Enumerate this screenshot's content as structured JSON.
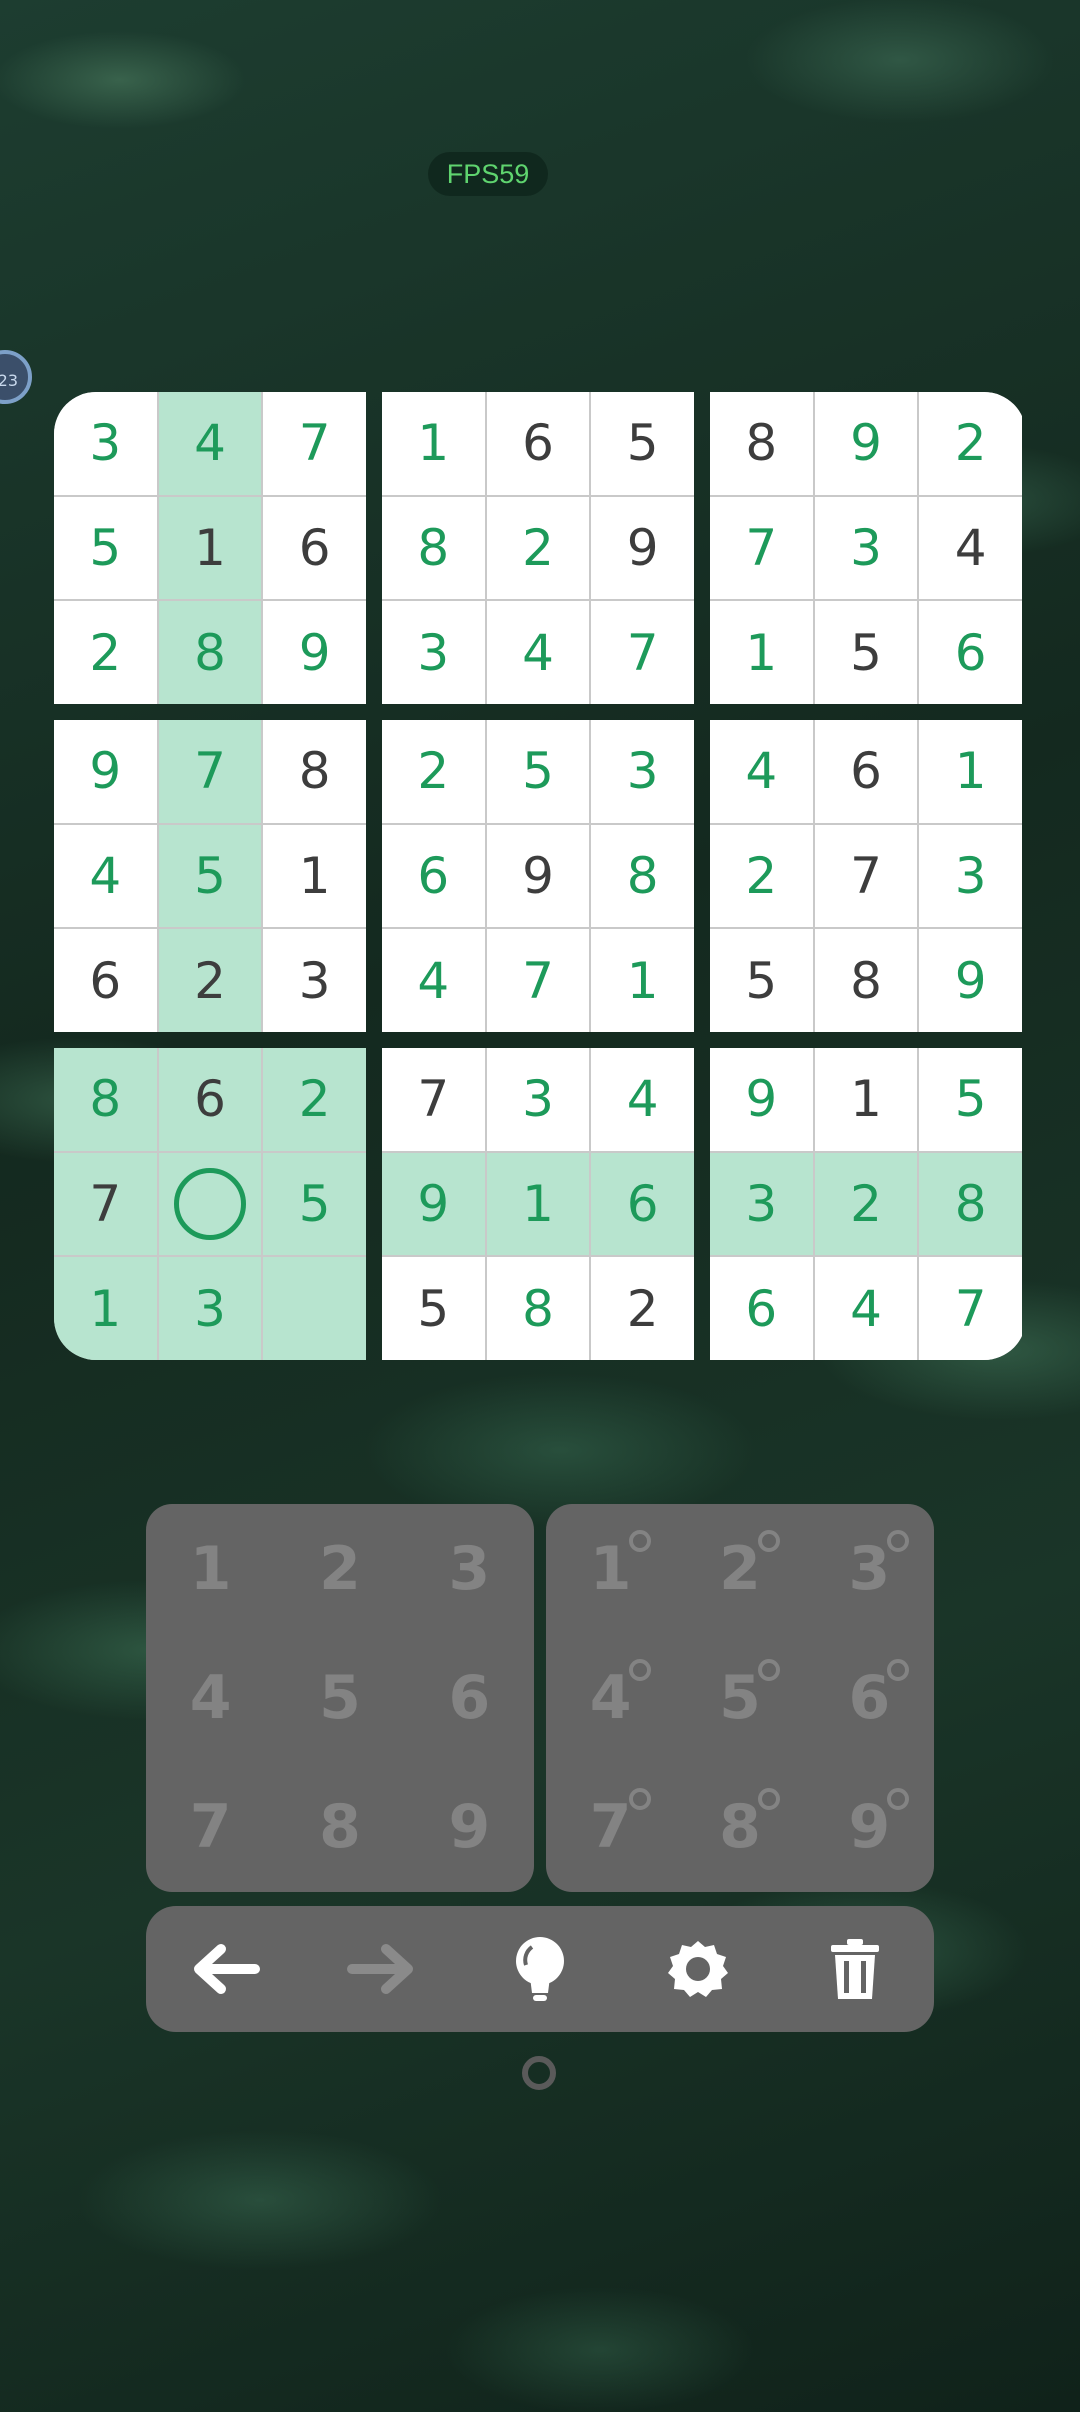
{
  "status": {
    "fps_label": "FPS59",
    "side_bubble": "23"
  },
  "board": {
    "values": [
      [
        "3",
        "4",
        "7",
        "1",
        "6",
        "5",
        "8",
        "9",
        "2"
      ],
      [
        "5",
        "1",
        "6",
        "8",
        "2",
        "9",
        "7",
        "3",
        "4"
      ],
      [
        "2",
        "8",
        "9",
        "3",
        "4",
        "7",
        "1",
        "5",
        "6"
      ],
      [
        "9",
        "7",
        "8",
        "2",
        "5",
        "3",
        "4",
        "6",
        "1"
      ],
      [
        "4",
        "5",
        "1",
        "6",
        "9",
        "8",
        "2",
        "7",
        "3"
      ],
      [
        "6",
        "2",
        "3",
        "4",
        "7",
        "1",
        "5",
        "8",
        "9"
      ],
      [
        "8",
        "6",
        "2",
        "7",
        "3",
        "4",
        "9",
        "1",
        "5"
      ],
      [
        "7",
        "",
        "5",
        "9",
        "1",
        "6",
        "3",
        "2",
        "8"
      ],
      [
        "1",
        "3",
        "",
        "5",
        "8",
        "2",
        "6",
        "4",
        "7"
      ]
    ],
    "given": [
      [
        false,
        false,
        false,
        false,
        true,
        true,
        true,
        false,
        false
      ],
      [
        false,
        true,
        true,
        false,
        false,
        true,
        false,
        false,
        true
      ],
      [
        false,
        false,
        false,
        false,
        false,
        false,
        false,
        true,
        false
      ],
      [
        false,
        false,
        true,
        false,
        false,
        false,
        false,
        true,
        false
      ],
      [
        false,
        false,
        true,
        false,
        true,
        false,
        false,
        true,
        false
      ],
      [
        true,
        true,
        true,
        false,
        false,
        false,
        true,
        true,
        false
      ],
      [
        false,
        true,
        false,
        true,
        false,
        false,
        false,
        true,
        false
      ],
      [
        true,
        false,
        false,
        false,
        false,
        false,
        false,
        false,
        false
      ],
      [
        false,
        false,
        false,
        true,
        false,
        true,
        false,
        false,
        false
      ]
    ],
    "selected": {
      "row": 7,
      "col": 1
    },
    "colors": {
      "entered": "#1d9a5a",
      "given": "#3d3d3d",
      "highlight": "#b7e4cf"
    }
  },
  "number_pad": {
    "digits": [
      "1",
      "2",
      "3",
      "4",
      "5",
      "6",
      "7",
      "8",
      "9"
    ]
  },
  "notes_pad": {
    "digits": [
      "1",
      "2",
      "3",
      "4",
      "5",
      "6",
      "7",
      "8",
      "9"
    ]
  },
  "toolbar": {
    "tools": [
      {
        "name": "undo-icon",
        "color": "#ffffff"
      },
      {
        "name": "redo-icon",
        "color": "#8a8a8a"
      },
      {
        "name": "hint-bulb-icon",
        "color": "#ffffff"
      },
      {
        "name": "settings-gear-icon",
        "color": "#ffffff"
      },
      {
        "name": "delete-trash-icon",
        "color": "#ffffff"
      }
    ]
  }
}
